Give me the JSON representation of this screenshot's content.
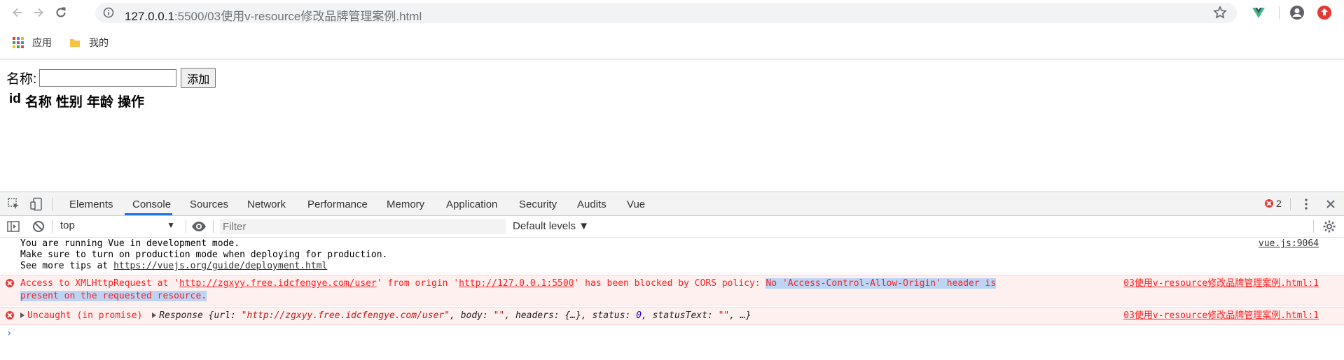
{
  "browser": {
    "url_host": "127.0.0.1",
    "url_rest": ":5500/03使用v-resource修改品牌管理案例.html",
    "bookmarks": [
      {
        "label": "应用",
        "icon": "apps-grid-icon"
      },
      {
        "label": "我的",
        "icon": "folder-icon"
      }
    ]
  },
  "page": {
    "name_label": "名称:",
    "add_button": "添加",
    "table_headers": [
      "id",
      "名称",
      "性别",
      "年龄",
      "操作"
    ]
  },
  "devtools": {
    "tabs": [
      "Elements",
      "Console",
      "Sources",
      "Network",
      "Performance",
      "Memory",
      "Application",
      "Security",
      "Audits",
      "Vue"
    ],
    "active_tab": "Console",
    "error_count": "2",
    "context": "top",
    "filter_placeholder": "Filter",
    "levels": "Default levels ▼",
    "messages": {
      "vue_line1": "You are running Vue in development mode.",
      "vue_line2": "Make sure to turn on production mode when deploying for production.",
      "vue_line3_prefix": "See more tips at ",
      "vue_link": "https://vuejs.org/guide/deployment.html",
      "vue_source": "vue.js:9064",
      "cors_part1": "Access to XMLHttpRequest at '",
      "cors_url1": "http://zgxyy.free.idcfengye.com/user",
      "cors_part2": "' from origin '",
      "cors_url2": "http://127.0.0.1:5500",
      "cors_part3": "' has been blocked by CORS policy: ",
      "cors_highlight1": "No 'Access-Control-Allow-Origin' header is",
      "cors_highlight2": "present on the requested resource.",
      "cors_source": "03使用v-resource修改品牌管理案例.html:1",
      "uncaught_label": "Uncaught (in promise)",
      "response_label": "Response ",
      "response_open": "{url: ",
      "response_url": "\"http://zgxyy.free.idcfengye.com/user\"",
      "response_body_key": ", body: ",
      "response_body": "\"\"",
      "response_headers": ", headers: {…}, status: ",
      "response_status": "0",
      "response_statustext_key": ", statusText: ",
      "response_statustext": "\"\"",
      "response_close": ", …}",
      "uncaught_source": "03使用v-resource修改品牌管理案例.html:1"
    }
  },
  "colors": {
    "accent": "#1a73e8",
    "error": "#fe2020",
    "error_bg": "#fff0f0",
    "selection": "#bcd5f5"
  }
}
